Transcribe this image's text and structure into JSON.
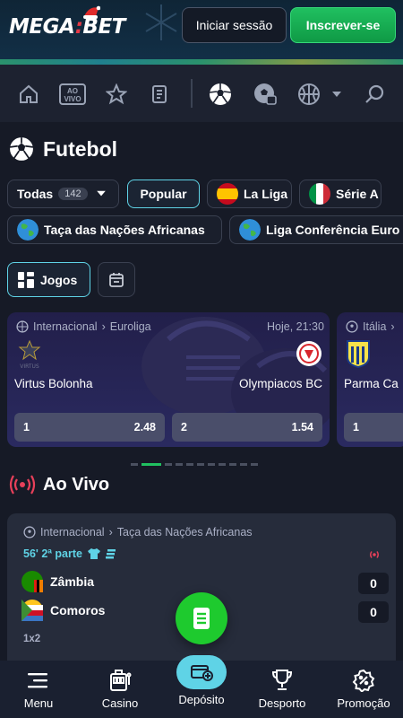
{
  "header": {
    "logo": "MEGA",
    "logo_dot": ":",
    "logo_tail": "BET",
    "login_label": "Iniciar sessão",
    "signup_label": "Inscrever-se"
  },
  "nav": {
    "aovivo_line1": "AO",
    "aovivo_line2": "VIVO"
  },
  "page_title": "Futebol",
  "filters": {
    "all_label": "Todas",
    "all_count": "142",
    "popular_label": "Popular",
    "laliga_label": "La Liga",
    "seriea_label": "Série A",
    "africa_label": "Taça das Nações Africanas",
    "conference_label": "Liga Conferência Euro"
  },
  "view": {
    "games_label": "Jogos"
  },
  "matches": [
    {
      "country": "Internacional",
      "league": "Euroliga",
      "time": "Hoje, 21:30",
      "home": "Virtus Bolonha",
      "away": "Olympiacos BC",
      "odd1_label": "1",
      "odd1": "2.48",
      "odd2_label": "2",
      "odd2": "1.54"
    },
    {
      "country": "Itália",
      "home": "Parma Ca",
      "odd1_label": "1"
    }
  ],
  "live": {
    "title": "Ao Vivo",
    "country": "Internacional",
    "league": "Taça das Nações Africanas",
    "time": "56' 2ª parte",
    "home": "Zâmbia",
    "home_score": "0",
    "away": "Comoros",
    "away_score": "0",
    "market": "1x2"
  },
  "bottom_nav": {
    "menu": "Menu",
    "casino": "Casino",
    "deposit": "Depósito",
    "sport": "Desporto",
    "promo": "Promoção"
  },
  "colors": {
    "accent_green": "#20c060",
    "accent_cyan": "#5fd3e6",
    "background": "#161a26"
  }
}
